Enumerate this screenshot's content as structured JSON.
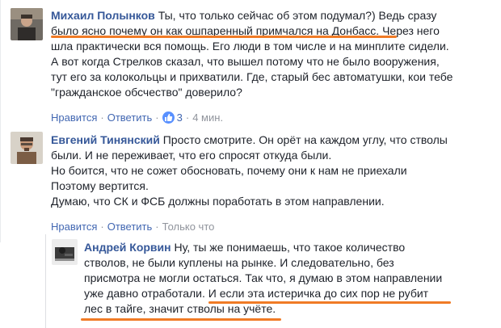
{
  "comments": [
    {
      "author": "Михаил Полынков",
      "lines": [
        "Ты, что только сейчас об этом подумал?) Ведь сразу",
        "было ясно почему он как ошпаренный примчался на Донбасс. Через него",
        "шла практически вся помощь. Его люди в том числе и на минплите сидели.",
        "А вот когда Стрелков сказал, что вышел потому что не было вооружения,",
        "тут его за колокольцы и прихватили. Где, старый бес автоматушки, кои тебе",
        "\"гражданское обсчество\" доверило?"
      ],
      "actions": {
        "like": "Нравится",
        "reply": "Ответить",
        "likes_count": "3",
        "time": "4 мин."
      }
    },
    {
      "author": "Евгений Тинянский",
      "lines": [
        "Просто смотрите. Он орёт на каждом углу, что стволы",
        "были. И не переживает, что его спросят откуда были.",
        "Но боится, что не сожет обосновать, почему они к нам не приехали",
        "Поэтому вертится.",
        "Думаю, что СК и ФСБ должны поработать в этом направлении."
      ],
      "actions": {
        "like": "Нравится",
        "reply": "Ответить",
        "time": "Только что"
      }
    },
    {
      "author": "Андрей Корвин",
      "lines": [
        "Ну, ты же понимаешь, что такое количество",
        "стволов, не были куплены на рынке. И следовательно, без",
        "присмотра не могли остаться. Так что, я думаю в этом направлении",
        "уже давно отработали. И если эта истеричка до сих пор не рубит",
        "лес в тайге, значит стволы на учёте."
      ]
    }
  ],
  "colors": {
    "author": "#365899",
    "link": "#4267b2",
    "muted": "#90949c",
    "highlight": "#f07b26",
    "like_badge": "#5890ff"
  }
}
